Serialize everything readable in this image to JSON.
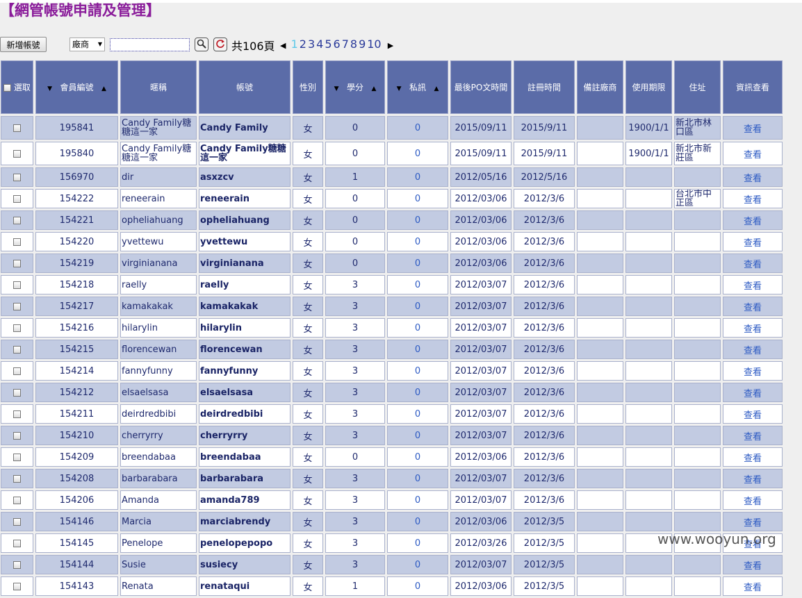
{
  "page_title": "【網管帳號申請及管理】",
  "toolbar": {
    "add_label": "新增帳號",
    "filter_value": "廠商",
    "search_value": "",
    "total_pages_text": "共106頁",
    "pages": [
      "1",
      "2",
      "3",
      "4",
      "5",
      "6",
      "7",
      "8",
      "9",
      "10"
    ],
    "current_page": "1"
  },
  "table": {
    "headers": {
      "select": "選取",
      "member_id": "會員編號",
      "nickname": "暱稱",
      "account": "帳號",
      "gender": "性別",
      "credits": "學分",
      "pm": "私訊",
      "last_post": "最後PO文時間",
      "registered": "註冊時間",
      "vendor_note": "備註廠商",
      "expiry": "使用期限",
      "address": "住址",
      "info": "資訊查看"
    },
    "rows": [
      {
        "id": "195841",
        "nick": "Candy Family糖糖這一家",
        "acct": "Candy Family",
        "gender": "女",
        "credits": "0",
        "pm": "0",
        "last_post": "2015/09/11",
        "reg": "2015/9/11",
        "vendor": "",
        "expiry": "1900/1/1",
        "addr": "新北市林口區",
        "view": "查看"
      },
      {
        "id": "195840",
        "nick": "Candy Family糖糖這一家",
        "acct": "Candy Family糖糖這一家",
        "gender": "女",
        "credits": "0",
        "pm": "0",
        "last_post": "2015/09/11",
        "reg": "2015/9/11",
        "vendor": "",
        "expiry": "1900/1/1",
        "addr": "新北市新莊區",
        "view": "查看"
      },
      {
        "id": "156970",
        "nick": "dir",
        "acct": "asxzcv",
        "gender": "女",
        "credits": "1",
        "pm": "0",
        "last_post": "2012/05/16",
        "reg": "2012/5/16",
        "vendor": "",
        "expiry": "",
        "addr": "",
        "view": "查看"
      },
      {
        "id": "154222",
        "nick": "reneerain",
        "acct": "reneerain",
        "gender": "女",
        "credits": "0",
        "pm": "0",
        "last_post": "2012/03/06",
        "reg": "2012/3/6",
        "vendor": "",
        "expiry": "",
        "addr": "台北市中正區",
        "view": "查看"
      },
      {
        "id": "154221",
        "nick": "opheliahuang",
        "acct": "opheliahuang",
        "gender": "女",
        "credits": "0",
        "pm": "0",
        "last_post": "2012/03/06",
        "reg": "2012/3/6",
        "vendor": "",
        "expiry": "",
        "addr": "",
        "view": "查看"
      },
      {
        "id": "154220",
        "nick": "yvettewu",
        "acct": "yvettewu",
        "gender": "女",
        "credits": "0",
        "pm": "0",
        "last_post": "2012/03/06",
        "reg": "2012/3/6",
        "vendor": "",
        "expiry": "",
        "addr": "",
        "view": "查看"
      },
      {
        "id": "154219",
        "nick": "virginianana",
        "acct": "virginianana",
        "gender": "女",
        "credits": "0",
        "pm": "0",
        "last_post": "2012/03/06",
        "reg": "2012/3/6",
        "vendor": "",
        "expiry": "",
        "addr": "",
        "view": "查看"
      },
      {
        "id": "154218",
        "nick": "raelly",
        "acct": "raelly",
        "gender": "女",
        "credits": "3",
        "pm": "0",
        "last_post": "2012/03/07",
        "reg": "2012/3/6",
        "vendor": "",
        "expiry": "",
        "addr": "",
        "view": "查看"
      },
      {
        "id": "154217",
        "nick": "kamakakak",
        "acct": "kamakakak",
        "gender": "女",
        "credits": "3",
        "pm": "0",
        "last_post": "2012/03/07",
        "reg": "2012/3/6",
        "vendor": "",
        "expiry": "",
        "addr": "",
        "view": "查看"
      },
      {
        "id": "154216",
        "nick": "hilarylin",
        "acct": "hilarylin",
        "gender": "女",
        "credits": "3",
        "pm": "0",
        "last_post": "2012/03/07",
        "reg": "2012/3/6",
        "vendor": "",
        "expiry": "",
        "addr": "",
        "view": "查看"
      },
      {
        "id": "154215",
        "nick": "florencewan",
        "acct": "florencewan",
        "gender": "女",
        "credits": "3",
        "pm": "0",
        "last_post": "2012/03/07",
        "reg": "2012/3/6",
        "vendor": "",
        "expiry": "",
        "addr": "",
        "view": "查看"
      },
      {
        "id": "154214",
        "nick": "fannyfunny",
        "acct": "fannyfunny",
        "gender": "女",
        "credits": "3",
        "pm": "0",
        "last_post": "2012/03/07",
        "reg": "2012/3/6",
        "vendor": "",
        "expiry": "",
        "addr": "",
        "view": "查看"
      },
      {
        "id": "154212",
        "nick": "elsaelsasa",
        "acct": "elsaelsasa",
        "gender": "女",
        "credits": "3",
        "pm": "0",
        "last_post": "2012/03/07",
        "reg": "2012/3/6",
        "vendor": "",
        "expiry": "",
        "addr": "",
        "view": "查看"
      },
      {
        "id": "154211",
        "nick": "deirdredbibi",
        "acct": "deirdredbibi",
        "gender": "女",
        "credits": "3",
        "pm": "0",
        "last_post": "2012/03/07",
        "reg": "2012/3/6",
        "vendor": "",
        "expiry": "",
        "addr": "",
        "view": "查看"
      },
      {
        "id": "154210",
        "nick": "cherryrry",
        "acct": "cherryrry",
        "gender": "女",
        "credits": "3",
        "pm": "0",
        "last_post": "2012/03/07",
        "reg": "2012/3/6",
        "vendor": "",
        "expiry": "",
        "addr": "",
        "view": "查看"
      },
      {
        "id": "154209",
        "nick": "breendabaa",
        "acct": "breendabaa",
        "gender": "女",
        "credits": "0",
        "pm": "0",
        "last_post": "2012/03/06",
        "reg": "2012/3/6",
        "vendor": "",
        "expiry": "",
        "addr": "",
        "view": "查看"
      },
      {
        "id": "154208",
        "nick": "barbarabara",
        "acct": "barbarabara",
        "gender": "女",
        "credits": "3",
        "pm": "0",
        "last_post": "2012/03/07",
        "reg": "2012/3/6",
        "vendor": "",
        "expiry": "",
        "addr": "",
        "view": "查看"
      },
      {
        "id": "154206",
        "nick": "Amanda",
        "acct": "amanda789",
        "gender": "女",
        "credits": "3",
        "pm": "0",
        "last_post": "2012/03/07",
        "reg": "2012/3/6",
        "vendor": "",
        "expiry": "",
        "addr": "",
        "view": "查看"
      },
      {
        "id": "154146",
        "nick": "Marcia",
        "acct": "marciabrendy",
        "gender": "女",
        "credits": "3",
        "pm": "0",
        "last_post": "2012/03/06",
        "reg": "2012/3/5",
        "vendor": "",
        "expiry": "",
        "addr": "",
        "view": "查看"
      },
      {
        "id": "154145",
        "nick": "Penelope",
        "acct": "penelopepopo",
        "gender": "女",
        "credits": "3",
        "pm": "0",
        "last_post": "2012/03/26",
        "reg": "2012/3/5",
        "vendor": "",
        "expiry": "",
        "addr": "",
        "view": "查看"
      },
      {
        "id": "154144",
        "nick": "Susie",
        "acct": "susiecy",
        "gender": "女",
        "credits": "3",
        "pm": "0",
        "last_post": "2012/03/07",
        "reg": "2012/3/5",
        "vendor": "",
        "expiry": "",
        "addr": "",
        "view": "查看"
      },
      {
        "id": "154143",
        "nick": "Renata",
        "acct": "renataqui",
        "gender": "女",
        "credits": "1",
        "pm": "0",
        "last_post": "2012/03/06",
        "reg": "2012/3/5",
        "vendor": "",
        "expiry": "",
        "addr": "",
        "view": "查看"
      }
    ]
  },
  "watermark": "www.wooyun.org"
}
